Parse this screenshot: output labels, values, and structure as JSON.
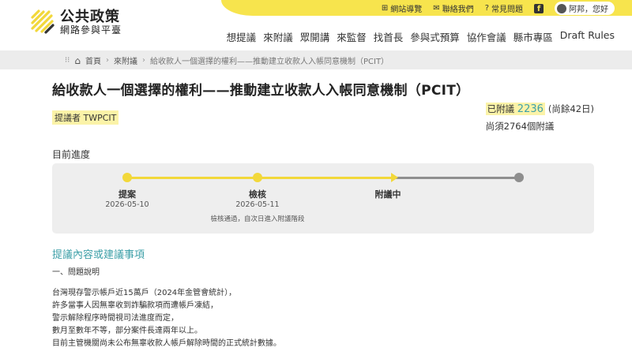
{
  "brand": {
    "title": "公共政策",
    "subtitle": "網路參與平臺"
  },
  "topbar": {
    "sitemap": "網站導覽",
    "contact": "聯絡我們",
    "faq": "常見問題",
    "fb": "f",
    "user": "阿邦，您好"
  },
  "nav": [
    "想提議",
    "來附議",
    "眾開講",
    "來監督",
    "找首長",
    "參與式預算",
    "協作會議",
    "縣市專區",
    "Draft Rules"
  ],
  "breadcrumb": {
    "home": "首頁",
    "section": "來附議",
    "current": "給收款人一個選擇的權利——推動建立收款人入帳同意機制（PCIT）"
  },
  "proposal": {
    "title": "給收款人一個選擇的權利——推動建立收款人入帳同意機制（PCIT）",
    "proposer": "提議者 TWPCIT",
    "signed_label": "已附議",
    "signed_count": "2236",
    "remaining_days": "(尚餘42日)",
    "needed": "尚須2764個附議"
  },
  "progress": {
    "label": "目前進度",
    "steps": [
      {
        "name": "提案",
        "date": "2026-05-10",
        "note": ""
      },
      {
        "name": "檢核",
        "date": "2026-05-11",
        "note": "檢核通過，自次日進入附議階段"
      },
      {
        "name": "附議中",
        "date": "",
        "note": ""
      }
    ]
  },
  "content": {
    "heading": "提議內容或建議事項",
    "lines": [
      "一、問題說明",
      "",
      "台灣現存警示帳戶近15萬戶（2024年金管會統計），",
      "許多當事人因無辜收到詐騙款項而遭帳戶凍結，",
      "警示解除程序時間視司法進度而定，",
      "數月至數年不等，部分案件長達兩年以上。",
      "目前主管機關尚未公布無辜收款人帳戶解除時間的正式統計數據。"
    ]
  },
  "colors": {
    "accent": "#f7e44d",
    "teal": "#3ea0a8",
    "track_todo": "#8e8e8e"
  }
}
